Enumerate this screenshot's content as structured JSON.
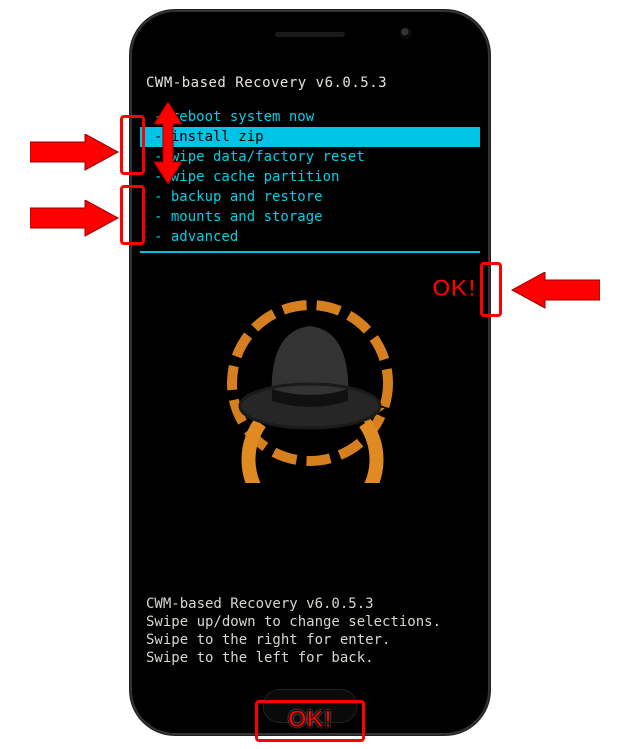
{
  "recovery": {
    "title": "CWM-based Recovery v6.0.5.3",
    "menu": [
      "reboot system now",
      "install zip",
      "wipe data/factory reset",
      "wipe cache partition",
      "backup and restore",
      "mounts and storage",
      "advanced"
    ],
    "selected_index": 1,
    "footer": {
      "line1": "CWM-based Recovery v6.0.5.3",
      "line2": "Swipe up/down to change selections.",
      "line3": "Swipe to the right for enter.",
      "line4": "Swipe to the left for back."
    }
  },
  "annotations": {
    "ok_label": "OK!",
    "arrow_color": "#ff0000",
    "box_color": "#ff0000"
  },
  "icons": {
    "hat": "clockworkmod-hat-icon",
    "arrow_left": "red-arrow-right-icon",
    "arrow_right": "red-arrow-left-icon",
    "arrow_updown": "red-double-arrow-icon"
  }
}
